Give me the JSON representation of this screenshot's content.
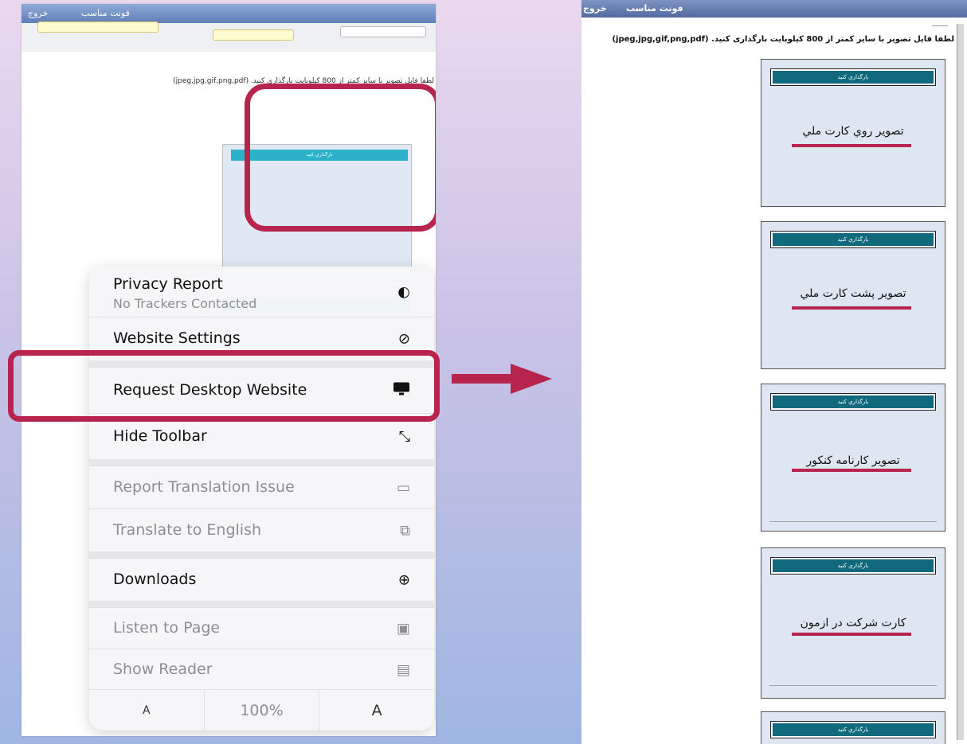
{
  "mobile_page": {
    "header": {
      "left_link": "خروج",
      "right_link": "فونت مناسب"
    },
    "notice": "لطفا فایل تصویر با سایز کمتر از 800 کیلوبایت بارگذاری کنید. (jpeg,jpg,gif,png,pdf)",
    "upload_button_label": "بارگذاري كنيد"
  },
  "safari_menu": {
    "privacy_report": {
      "label": "Privacy Report",
      "sublabel": "No Trackers Contacted",
      "icon": "shield-icon"
    },
    "website_settings": {
      "label": "Website Settings",
      "icon": "gauge-icon"
    },
    "request_desktop": {
      "label": "Request Desktop Website",
      "icon": "monitor-icon"
    },
    "hide_toolbar": {
      "label": "Hide Toolbar",
      "icon": "arrows-icon"
    },
    "report_translation": {
      "label": "Report Translation Issue",
      "icon": "speech-bubble-icon"
    },
    "translate_english": {
      "label": "Translate to English",
      "icon": "translate-icon"
    },
    "downloads": {
      "label": "Downloads",
      "icon": "download-icon"
    },
    "listen_page": {
      "label": "Listen to Page",
      "icon": "speaker-icon"
    },
    "show_reader": {
      "label": "Show Reader",
      "icon": "reader-icon"
    },
    "zoom": {
      "smaller": "A",
      "level": "100%",
      "larger": "A"
    }
  },
  "desktop_page": {
    "header": {
      "left_link": "خروج",
      "right_link": "فونت مناسب"
    },
    "notice": "لطفا فایل تصویر با سایز کمتر از 800 کیلوبایت بارگذاری کنید. (jpeg,jpg,gif,png,pdf)",
    "cards": [
      {
        "button": "بارگذاري كنيد",
        "title": "تصوير روي كارت ملي"
      },
      {
        "button": "بارگذاري كنيد",
        "title": "تصوير پشت كارت ملي"
      },
      {
        "button": "بارگذاري كنيد",
        "title": "تصوير كارنامه كنكور"
      },
      {
        "button": "بارگذاري كنيد",
        "title": "كارت شركت در ازمون"
      },
      {
        "button": "بارگذاري كنيد",
        "title": ""
      }
    ]
  },
  "colors": {
    "highlight": "#b7254f",
    "upload_bar": "#10697c",
    "mobile_bar": "#2bb1c8"
  }
}
